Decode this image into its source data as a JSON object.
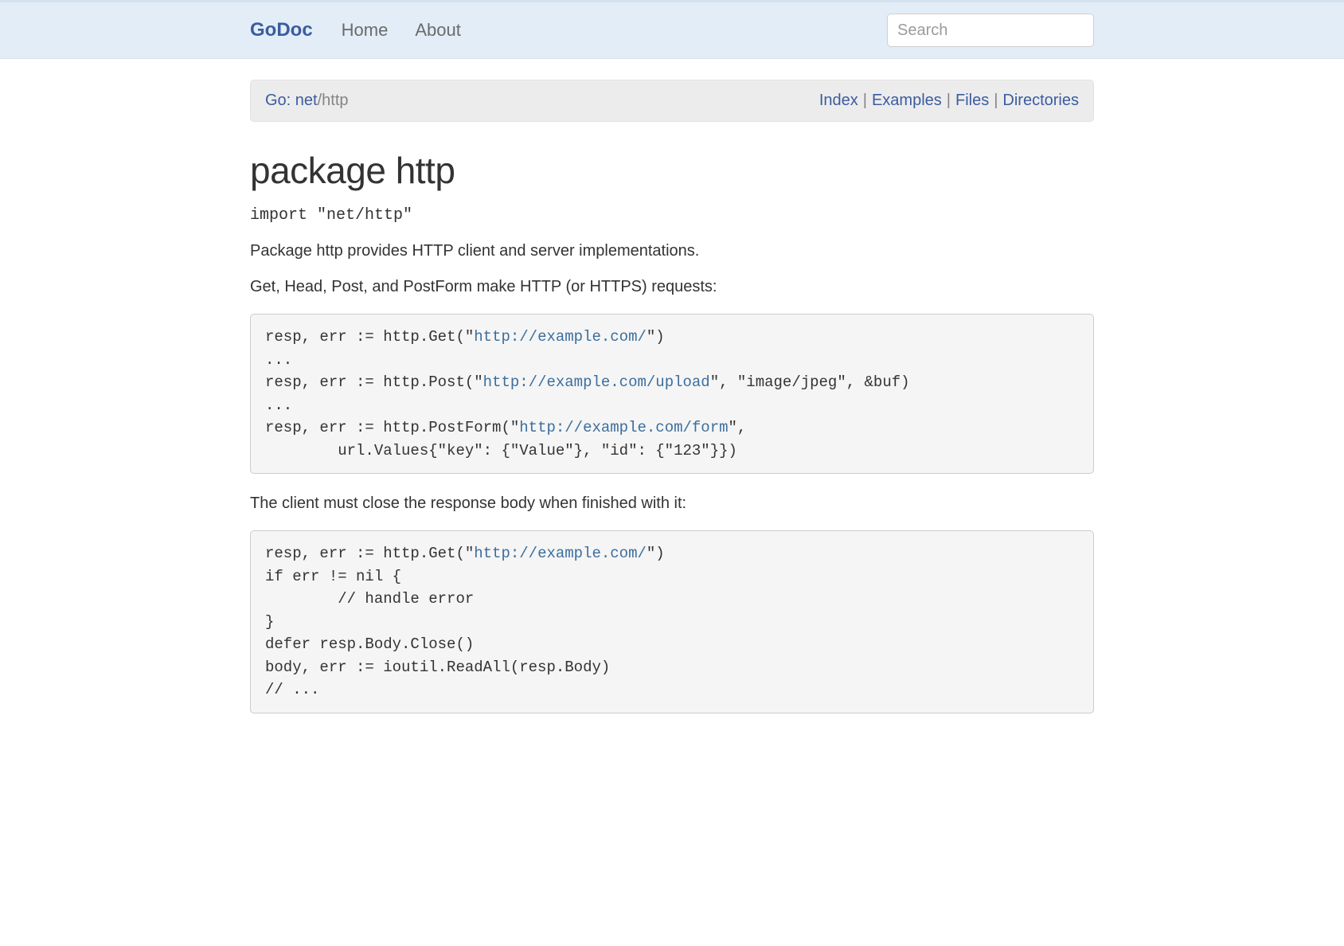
{
  "header": {
    "brand": "GoDoc",
    "nav": {
      "home": "Home",
      "about": "About"
    },
    "search_placeholder": "Search"
  },
  "breadcrumb": {
    "go": "Go: ",
    "net": "net",
    "slash": "/",
    "http": "http"
  },
  "pagenav": {
    "index": "Index",
    "examples": "Examples",
    "files": "Files",
    "directories": "Directories"
  },
  "title": "package http",
  "import_line": "import \"net/http\"",
  "para1": "Package http provides HTTP client and server implementations.",
  "para2": "Get, Head, Post, and PostForm make HTTP (or HTTPS) requests:",
  "code1": {
    "l1a": "resp, err := http.Get(\"",
    "l1url": "http://example.com/",
    "l1b": "\")",
    "l2": "...",
    "l3a": "resp, err := http.Post(\"",
    "l3url": "http://example.com/upload",
    "l3b": "\", \"image/jpeg\", &buf)",
    "l4": "...",
    "l5a": "resp, err := http.PostForm(\"",
    "l5url": "http://example.com/form",
    "l5b": "\",",
    "l6": "        url.Values{\"key\": {\"Value\"}, \"id\": {\"123\"}})"
  },
  "para3": "The client must close the response body when finished with it:",
  "code2": {
    "l1a": "resp, err := http.Get(\"",
    "l1url": "http://example.com/",
    "l1b": "\")",
    "l2": "if err != nil {",
    "l3": "        // handle error",
    "l4": "}",
    "l5": "defer resp.Body.Close()",
    "l6": "body, err := ioutil.ReadAll(resp.Body)",
    "l7": "// ..."
  },
  "colors": {
    "link": "#3B5CA0",
    "topbar_bg": "#E2EDF7",
    "code_bg": "#F5F5F5",
    "code_url": "#3B6E9E"
  }
}
